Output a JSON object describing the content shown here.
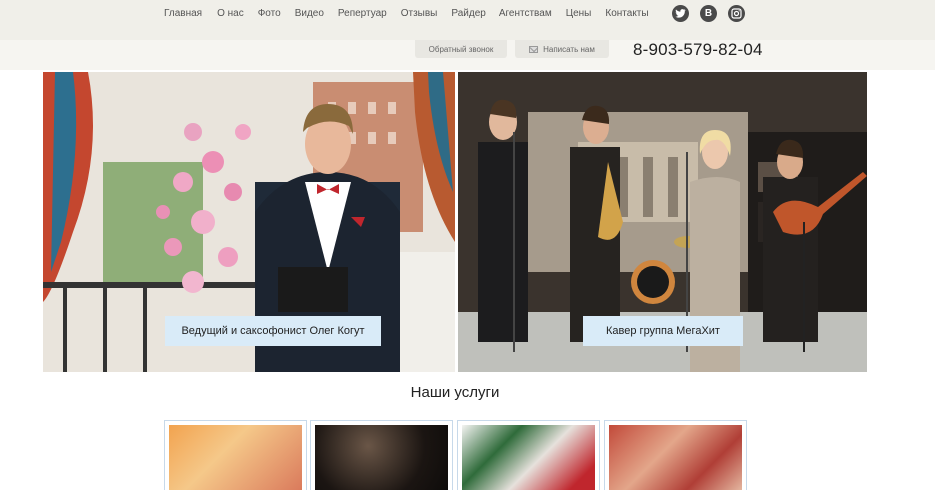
{
  "nav": {
    "items": [
      "Главная",
      "О нас",
      "Фото",
      "Видео",
      "Репертуар",
      "Отзывы",
      "Райдер",
      "Агентствам",
      "Цены",
      "Контакты"
    ]
  },
  "social": {
    "twitter": "twitter-icon",
    "vk": "B",
    "instagram": "instagram-icon"
  },
  "contact": {
    "callback_label": "Обратный звонок",
    "write_label": "Написать нам",
    "phone": "8-903-579-82-04"
  },
  "hero": {
    "left_caption": "Ведущий и саксофонист Олег Когут",
    "right_caption": "Кавер группа МегаХит"
  },
  "services": {
    "title": "Наши услуги"
  },
  "colors": {
    "topbar": "#f0efe9",
    "caption_bg": "#d9ebf8",
    "thumb_border": "#c7d9ea",
    "icon_dark": "#4a4a4a"
  }
}
